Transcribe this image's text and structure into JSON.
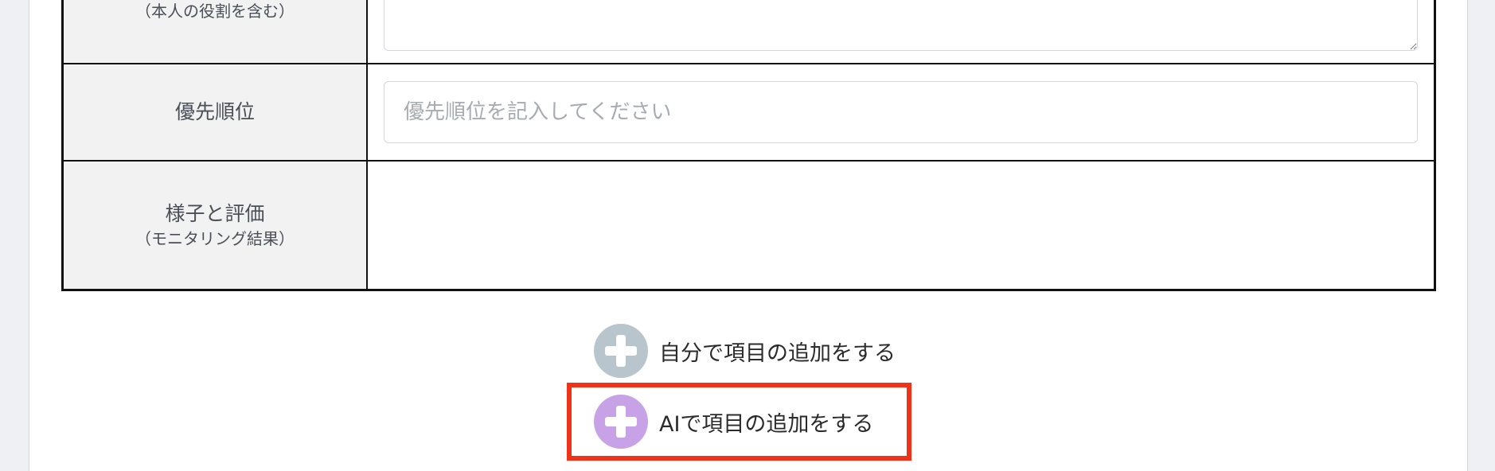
{
  "form": {
    "rows": [
      {
        "label_sub": "（本人の役割を含む）"
      },
      {
        "label": "優先順位",
        "placeholder": "優先順位を記入してください",
        "value": ""
      },
      {
        "label": "様子と評価",
        "label_sub": "（モニタリング結果）"
      }
    ]
  },
  "actions": {
    "add_self": {
      "label": "自分で項目の追加をする",
      "icon": "plus-icon",
      "color": "#b8c5cc"
    },
    "add_ai": {
      "label": "AIで項目の追加をする",
      "icon": "plus-icon",
      "color": "#c8a2e6",
      "highlight_color": "#ee3319"
    }
  }
}
